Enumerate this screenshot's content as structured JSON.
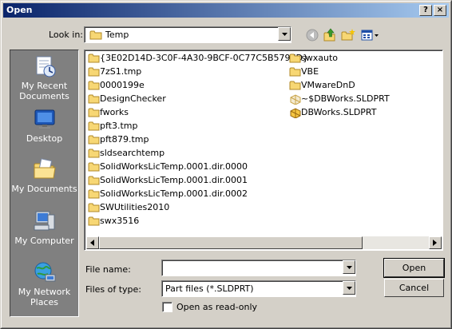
{
  "window": {
    "title": "Open",
    "help_glyph": "?",
    "close_glyph": "×"
  },
  "lookin": {
    "label": "Look in:",
    "value": "Temp"
  },
  "toolbar": {
    "icons": [
      "back-icon",
      "up-folder-icon",
      "new-folder-icon",
      "views-menu-icon"
    ]
  },
  "places": [
    {
      "name": "recent",
      "label": "My Recent Documents",
      "icon": "recent-documents-icon"
    },
    {
      "name": "desktop",
      "label": "Desktop",
      "icon": "desktop-icon"
    },
    {
      "name": "documents",
      "label": "My Documents",
      "icon": "my-documents-icon"
    },
    {
      "name": "computer",
      "label": "My Computer",
      "icon": "my-computer-icon"
    },
    {
      "name": "network",
      "label": "My Network Places",
      "icon": "network-places-icon"
    }
  ],
  "files": {
    "column1": [
      {
        "name": "{3E02D14D-3C0F-4A30-9BCF-0C77C5B5797D}",
        "type": "folder"
      },
      {
        "name": "7zS1.tmp",
        "type": "folder"
      },
      {
        "name": "0000199e",
        "type": "folder"
      },
      {
        "name": "DesignChecker",
        "type": "folder"
      },
      {
        "name": "fworks",
        "type": "folder"
      },
      {
        "name": "pft3.tmp",
        "type": "folder"
      },
      {
        "name": "pft879.tmp",
        "type": "folder"
      },
      {
        "name": "sldsearchtemp",
        "type": "folder"
      },
      {
        "name": "SolidWorksLicTemp.0001.dir.0000",
        "type": "folder"
      },
      {
        "name": "SolidWorksLicTemp.0001.dir.0001",
        "type": "folder"
      },
      {
        "name": "SolidWorksLicTemp.0001.dir.0002",
        "type": "folder"
      },
      {
        "name": "SWUtilities2010",
        "type": "folder"
      },
      {
        "name": "swx3516",
        "type": "folder"
      }
    ],
    "column2": [
      {
        "name": "swxauto",
        "type": "folder"
      },
      {
        "name": "VBE",
        "type": "folder"
      },
      {
        "name": "VMwareDnD",
        "type": "folder"
      },
      {
        "name": "~$DBWorks.SLDPRT",
        "type": "part-ghost"
      },
      {
        "name": "DBWorks.SLDPRT",
        "type": "part"
      }
    ]
  },
  "form": {
    "filename_label": "File name:",
    "filename_value": "",
    "filetype_label": "Files of type:",
    "filetype_value": "Part files (*.SLDPRT)",
    "readonly_label": "Open as read-only",
    "readonly_checked": false
  },
  "buttons": {
    "open": "Open",
    "cancel": "Cancel"
  }
}
